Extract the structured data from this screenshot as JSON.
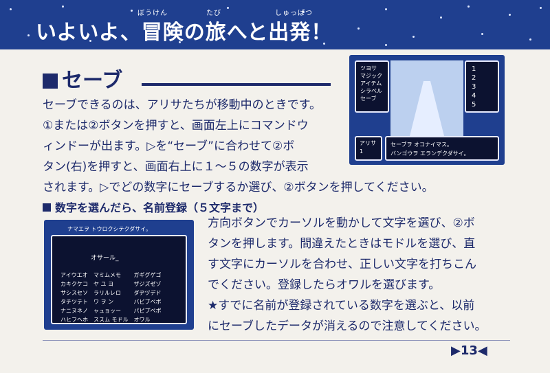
{
  "banner": {
    "title": "いよいよ、冒険の旅へと出発！",
    "ruby": [
      "ぼうけん",
      "たび",
      "しゅっぱつ"
    ]
  },
  "section": {
    "title": "セーブ"
  },
  "screen1": {
    "menu": [
      "ツヨサ",
      "マジック",
      "アイテム",
      "シラベル",
      "セーブ"
    ],
    "slots": [
      "1",
      "2",
      "3",
      "4",
      "5"
    ],
    "name": "アリサ",
    "level": "1",
    "message": [
      "セーブヲ オコナイマス。",
      "バンゴウヲ エランデクダサイ。"
    ]
  },
  "body": {
    "lines": [
      "セーブできるのは、アリサたちが移動中のときです。",
      "①または②ボタンを押すと、画面左上にコマンドウ",
      "ィンドーが出ます。▷を“セーブ”に合わせて②ボ",
      "タン(右)を押すと、画面右上に１～５の数字が表示"
    ],
    "last_line": "されます。▷でどの数字にセーブするか選び、②ボタンを押してください。"
  },
  "subheading": "数字を選んだら、名前登録（５文字まで）",
  "screen2": {
    "top": "ナマエヲ トウロクシテクダサイ。",
    "name_field": "オサール_",
    "grid": [
      [
        "アイウエオ",
        "マミムメモ",
        "ガギグゲゴ"
      ],
      [
        "カキクケコ",
        "ヤ ユ ヨ",
        "ザジズゼゾ"
      ],
      [
        "サシスセソ",
        "ラリルレロ",
        "ダヂヅデド"
      ],
      [
        "タチツテト",
        "ワ ヲ ン",
        "バビブベボ"
      ],
      [
        "ナニヌネノ",
        "ャュョッー",
        "パピプペポ"
      ],
      [
        "ハヒフヘホ",
        "ススム モドル",
        "オワル"
      ]
    ]
  },
  "body2": {
    "lines": [
      "方向ボタンでカーソルを動かして文字を選び、②ボ",
      "タンを押します。間違えたときはモドルを選び、直",
      "す文字にカーソルを合わせ、正しい文字を打ちこん",
      "でください。登録したらオワルを選びます。",
      "★すでに名前が登録されている数字を選ぶと、以前",
      "にセーブしたデータが消えるので注意してください。"
    ]
  },
  "page": {
    "number": "▶13◀"
  }
}
